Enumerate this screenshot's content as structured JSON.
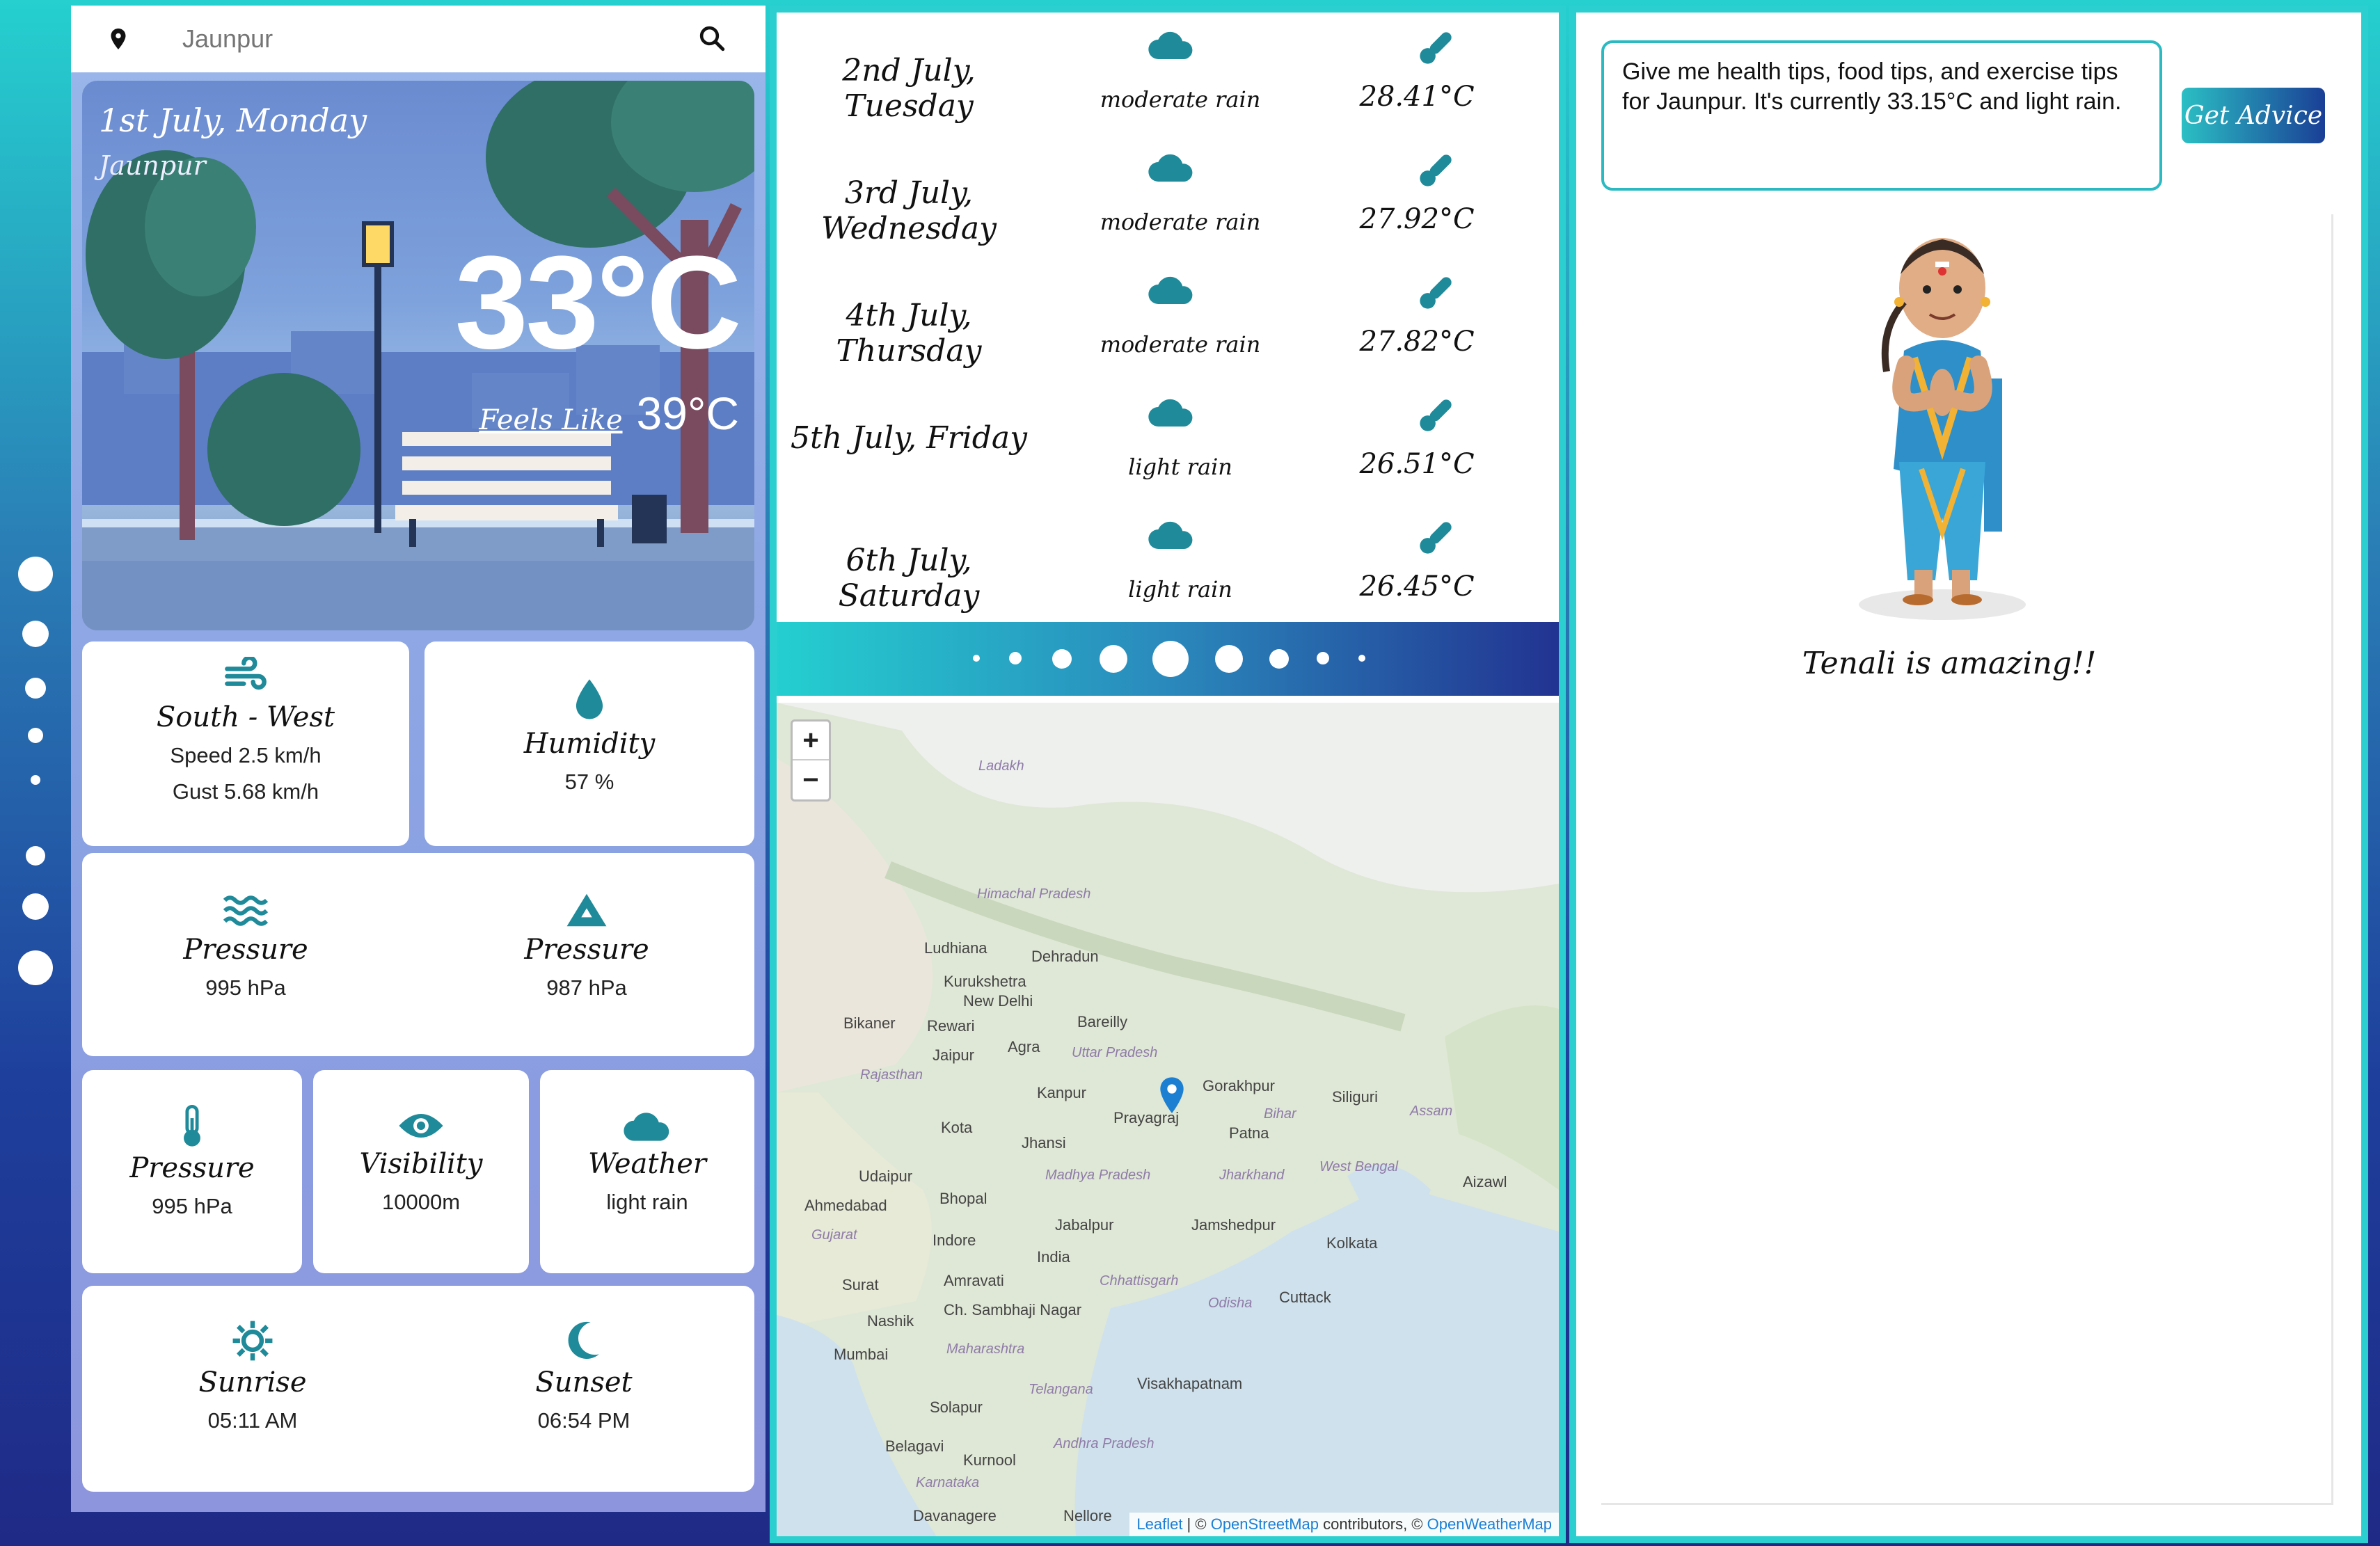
{
  "search": {
    "placeholder": "Jaunpur"
  },
  "current": {
    "date": "1st July, Monday",
    "city": "Jaunpur",
    "temperature": "33°C",
    "feels_like_label": "Feels Like",
    "feels_like": "39°C"
  },
  "details": {
    "wind": {
      "title": "South - West",
      "speed": "Speed 2.5 km/h",
      "gust": "Gust 5.68 km/h",
      "icon": "wind-icon"
    },
    "humidity": {
      "title": "Humidity",
      "value": "57 %",
      "icon": "droplet-icon"
    },
    "pressure_sea": {
      "title": "Pressure",
      "value": "995 hPa",
      "icon": "waves-icon"
    },
    "pressure_ground": {
      "title": "Pressure",
      "value": "987 hPa",
      "icon": "mountain-icon"
    },
    "pressure_temp": {
      "title": "Pressure",
      "value": "995 hPa",
      "icon": "thermometer-icon"
    },
    "visibility": {
      "title": "Visibility",
      "value": "10000m",
      "icon": "eye-icon"
    },
    "weather": {
      "title": "Weather",
      "value": "light rain",
      "icon": "cloud-icon"
    },
    "sunrise": {
      "title": "Sunrise",
      "value": "05:11 AM",
      "icon": "sun-icon"
    },
    "sunset": {
      "title": "Sunset",
      "value": "06:54 PM",
      "icon": "moon-icon"
    }
  },
  "forecast": [
    {
      "date": "2nd July, Tuesday",
      "desc": "moderate rain",
      "temp": "28.41°C"
    },
    {
      "date": "3rd July, Wednesday",
      "desc": "moderate rain",
      "temp": "27.92°C"
    },
    {
      "date": "4th July, Thursday",
      "desc": "moderate rain",
      "temp": "27.82°C"
    },
    {
      "date": "5th July, Friday",
      "desc": "light rain",
      "temp": "26.51°C"
    },
    {
      "date": "6th July, Saturday",
      "desc": "light rain",
      "temp": "26.45°C"
    }
  ],
  "map": {
    "zoom_in": "+",
    "zoom_out": "−",
    "places": [
      "Ladakh",
      "Himachal Pradesh",
      "Ludhiana",
      "Dehradun",
      "Kurukshetra",
      "New Delhi",
      "Bikaner",
      "Rewari",
      "Bareilly",
      "Jaipur",
      "Agra",
      "Uttar Pradesh",
      "Rajasthan",
      "Kanpur",
      "Gorakhpur",
      "Siliguri",
      "Prayagraj",
      "Bihar",
      "Assam",
      "Kota",
      "Jhansi",
      "Patna",
      "Udaipur",
      "Madhya Pradesh",
      "Jharkhand",
      "West Bengal",
      "Aizawl",
      "Ahmedabad",
      "Bhopal",
      "Jamshedpur",
      "Gujarat",
      "Indore",
      "Jabalpur",
      "Kolkata",
      "India",
      "Amravati",
      "Chhattisgarh",
      "Surat",
      "Cuttack",
      "Ch. Sambhaji Nagar",
      "Odisha",
      "Nashik",
      "Maharashtra",
      "Mumbai",
      "Visakhapatnam",
      "Telangana",
      "Solapur",
      "Belagavi",
      "Andhra Pradesh",
      "Kurnool",
      "Karnataka",
      "Davanagere",
      "Nellore",
      "Bhopal"
    ],
    "attribution": {
      "leaflet": "Leaflet",
      "sep1": " | © ",
      "osm": "OpenStreetMap",
      "sep2": " contributors, © ",
      "owm": "OpenWeatherMap"
    }
  },
  "advisor": {
    "prompt": "Give me health tips, food tips, and exercise tips for Jaunpur. It's currently 33.15°C and light rain.",
    "button": "Get Advice",
    "caption": "Tenali is amazing!!"
  },
  "colors": {
    "accent": "#2ccfcf",
    "icon": "#1f8a99",
    "navy": "#1f2a86"
  }
}
